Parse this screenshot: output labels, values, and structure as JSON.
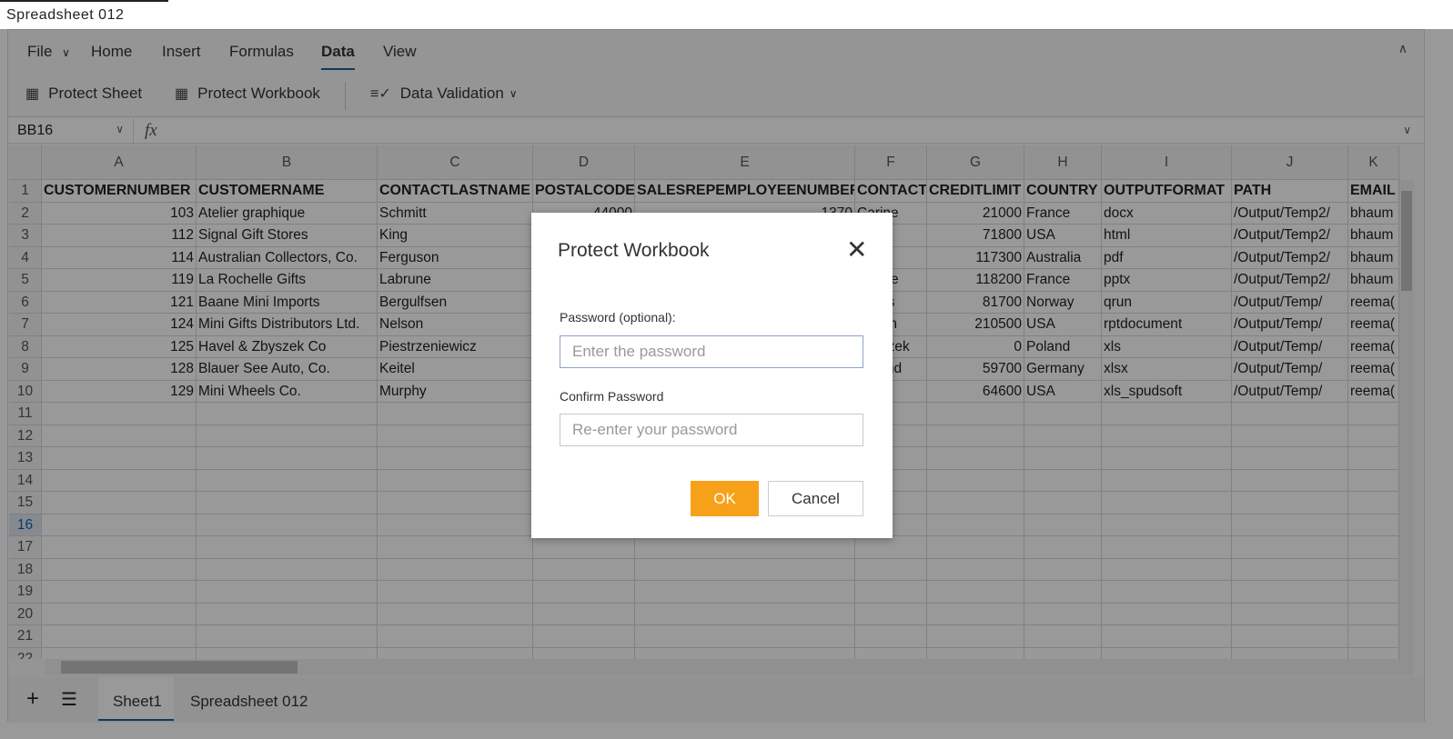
{
  "window": {
    "title": "Spreadsheet 012"
  },
  "ribbon": {
    "tabs": [
      "File",
      "Home",
      "Insert",
      "Formulas",
      "Data",
      "View"
    ],
    "active_tab": "Data"
  },
  "toolbar": {
    "protect_sheet": "Protect Sheet",
    "protect_workbook": "Protect Workbook",
    "data_validation": "Data Validation"
  },
  "formula_bar": {
    "cell_ref": "BB16",
    "fx": "fx",
    "value": ""
  },
  "grid": {
    "columns": [
      "A",
      "B",
      "C",
      "D",
      "E",
      "F",
      "G",
      "H",
      "I",
      "J",
      "K"
    ],
    "row_numbers": [
      "1",
      "2",
      "3",
      "4",
      "5",
      "6",
      "7",
      "8",
      "9",
      "10",
      "11",
      "12",
      "13",
      "14",
      "15",
      "16",
      "17",
      "18",
      "19",
      "20",
      "21",
      "22"
    ],
    "selected_row": "16",
    "rows": [
      [
        "CUSTOMERNUMBER",
        "CUSTOMERNAME",
        "CONTACTLASTNAME",
        "POSTALCODE",
        "SALESREPEMPLOYEENUMBER",
        "CONTACT",
        "CREDITLIMIT",
        "COUNTRY",
        "OUTPUTFORMAT",
        "PATH",
        "EMAIL"
      ],
      [
        "103",
        "Atelier graphique",
        "Schmitt",
        "44000",
        "1370",
        "Carine",
        "21000",
        "France",
        "docx",
        "/Output/Temp2/",
        "bhaum"
      ],
      [
        "112",
        "Signal Gift Stores",
        "King",
        "",
        "",
        "",
        "71800",
        "USA",
        "html",
        "/Output/Temp2/",
        "bhaum"
      ],
      [
        "114",
        "Australian Collectors, Co.",
        "Ferguson",
        "",
        "",
        "",
        "117300",
        "Australia",
        "pdf",
        "/Output/Temp2/",
        "bhaum"
      ],
      [
        "119",
        "La Rochelle Gifts",
        "Labrune",
        "",
        "",
        "Janine",
        "118200",
        "France",
        "pptx",
        "/Output/Temp2/",
        "bhaum"
      ],
      [
        "121",
        "Baane Mini Imports",
        "Bergulfsen",
        "",
        "",
        "Jonas",
        "81700",
        "Norway",
        "qrun",
        "/Output/Temp/",
        "reema("
      ],
      [
        "124",
        "Mini Gifts Distributors Ltd.",
        "Nelson",
        "",
        "",
        "Susan",
        "210500",
        "USA",
        "rptdocument",
        "/Output/Temp/",
        "reema("
      ],
      [
        "125",
        "Havel & Zbyszek Co",
        "Piestrzeniewicz",
        "",
        "",
        "Zbyszek",
        "0",
        "Poland",
        "xls",
        "/Output/Temp/",
        "reema("
      ],
      [
        "128",
        "Blauer See Auto, Co.",
        "Keitel",
        "",
        "",
        "Roland",
        "59700",
        "Germany",
        "xlsx",
        "/Output/Temp/",
        "reema("
      ],
      [
        "129",
        "Mini Wheels Co.",
        "Murphy",
        "",
        "",
        "",
        "64600",
        "USA",
        "xls_spudsoft",
        "/Output/Temp/",
        "reema("
      ]
    ]
  },
  "sheets": {
    "tabs": [
      "Sheet1",
      "Spreadsheet 012"
    ],
    "active": "Sheet1"
  },
  "dialog": {
    "title": "Protect Workbook",
    "password_label": "Password (optional):",
    "password_placeholder": "Enter the password",
    "confirm_label": "Confirm Password",
    "confirm_placeholder": "Re-enter your password",
    "ok": "OK",
    "cancel": "Cancel"
  },
  "colors": {
    "accent": "#f7a11a",
    "tab_underline": "#1a5fa0"
  }
}
